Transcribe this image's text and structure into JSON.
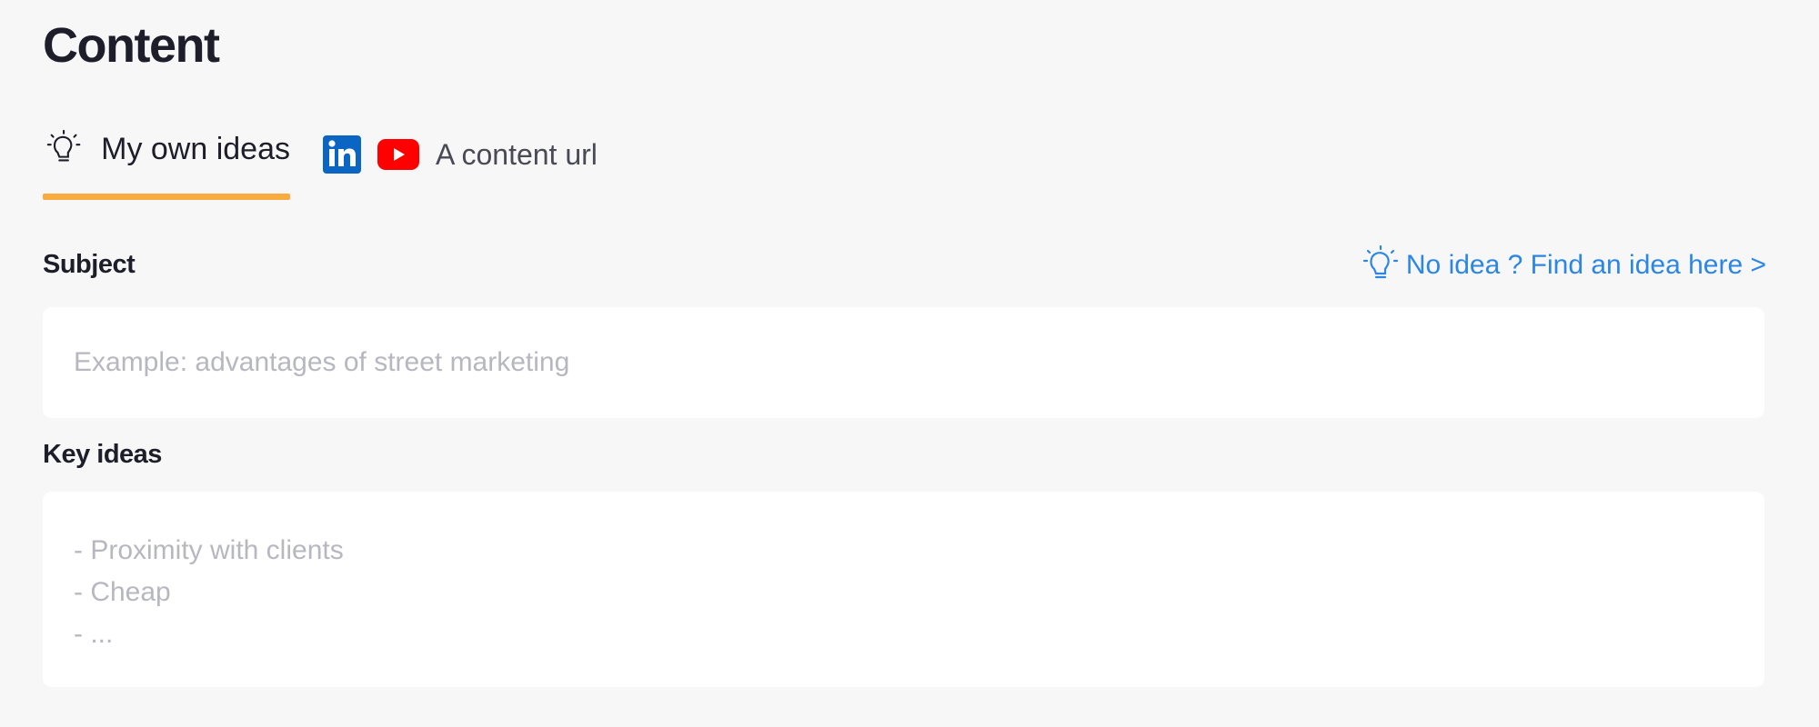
{
  "page": {
    "title": "Content"
  },
  "tabs": {
    "own_ideas": {
      "label": "My own ideas",
      "icon": "lightbulb-icon",
      "active": true,
      "indicator_color": "#f9ab3f"
    },
    "content_url": {
      "label": "A content url",
      "icons": [
        "linkedin-icon",
        "youtube-icon"
      ],
      "active": false
    }
  },
  "subject": {
    "label": "Subject",
    "placeholder": "Example: advantages of street marketing",
    "value": ""
  },
  "idea_link": {
    "label": "No idea ? Find an idea here >",
    "icon": "lightbulb-icon",
    "color": "#2b86e6"
  },
  "key_ideas": {
    "label": "Key ideas",
    "placeholder": "- Proximity with clients\n- Cheap\n- ...",
    "value": ""
  },
  "linkedin_logo": {
    "text": "in",
    "color": "#0a66c2"
  },
  "youtube_logo": {
    "color": "#ff0000"
  }
}
